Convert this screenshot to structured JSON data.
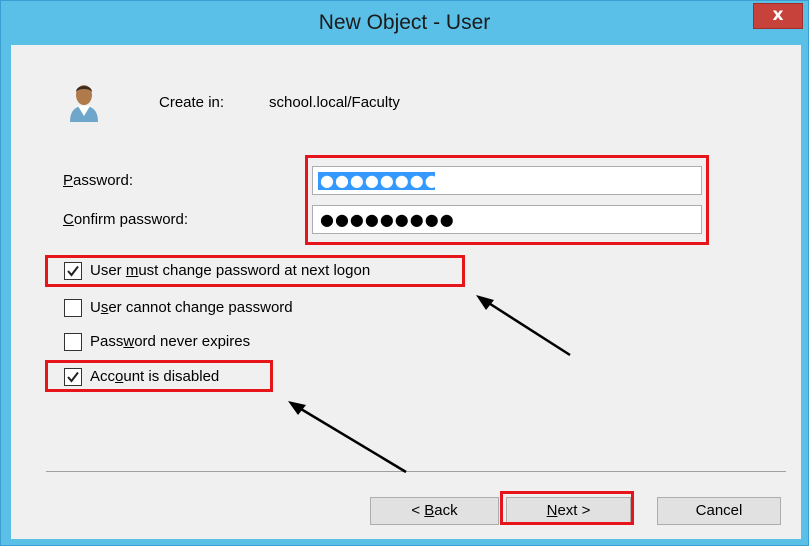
{
  "window": {
    "title": "New Object - User",
    "close_label": "x"
  },
  "header": {
    "icon": "user-icon",
    "create_in_label": "Create in:",
    "create_in_path": "school.local/Faculty"
  },
  "fields": {
    "password": {
      "label_underlined": "P",
      "label_rest": "assword:",
      "value_masked": "●●●●●●●●●",
      "selected": true
    },
    "confirm_password": {
      "label_underlined": "C",
      "label_rest": "onfirm password:",
      "value_masked": "●●●●●●●●●"
    }
  },
  "options": [
    {
      "pre": "User ",
      "u": "m",
      "post": "ust change password at next logon",
      "checked": true
    },
    {
      "pre": "U",
      "u": "s",
      "post": "er cannot change password",
      "checked": false
    },
    {
      "pre": "Pass",
      "u": "w",
      "post": "ord never expires",
      "checked": false
    },
    {
      "pre": "Acc",
      "u": "o",
      "post": "unt is disabled",
      "checked": true
    }
  ],
  "buttons": {
    "back_pre": "< ",
    "back_u": "B",
    "back_post": "ack",
    "next_u": "N",
    "next_post": "ext >",
    "cancel": "Cancel"
  },
  "colors": {
    "titlebar": "#5bc0e8",
    "highlight": "#e8141b",
    "selection": "#3399ff"
  }
}
